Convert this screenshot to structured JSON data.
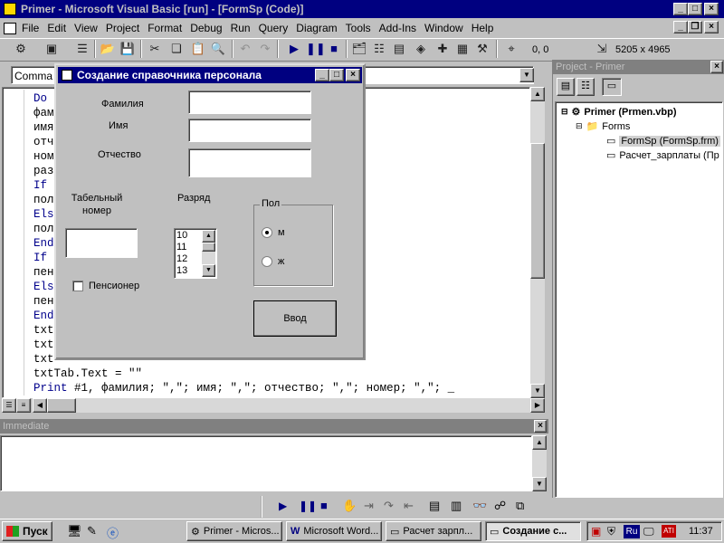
{
  "main_window": {
    "title": "Primer - Microsoft Visual Basic [run] - [FormSp (Code)]",
    "menu": [
      "File",
      "Edit",
      "View",
      "Project",
      "Format",
      "Debug",
      "Run",
      "Query",
      "Diagram",
      "Tools",
      "Add-Ins",
      "Window",
      "Help"
    ],
    "toolbar": {
      "position_readout": "0, 0",
      "size_readout": "5205 x 4965"
    }
  },
  "code_window": {
    "object_combo": "Comma",
    "lines": [
      {
        "kw": "Do ",
        "rest": ""
      },
      {
        "kw": "",
        "rest": "фам"
      },
      {
        "kw": "",
        "rest": "имя"
      },
      {
        "kw": "",
        "rest": "отч"
      },
      {
        "kw": "",
        "rest": "ном"
      },
      {
        "kw": "",
        "rest": "раз"
      },
      {
        "kw": "If ",
        "rest": ""
      },
      {
        "kw": "",
        "rest": "пол"
      },
      {
        "kw": "Els",
        "rest": ""
      },
      {
        "kw": "",
        "rest": "пол"
      },
      {
        "kw": "End",
        "rest": ""
      },
      {
        "kw": "If ",
        "rest": ""
      },
      {
        "kw": "",
        "rest": "пен"
      },
      {
        "kw": "Els",
        "rest": ""
      },
      {
        "kw": "",
        "rest": "пен"
      },
      {
        "kw": "End",
        "rest": ""
      },
      {
        "kw": "",
        "rest": "txt"
      },
      {
        "kw": "",
        "rest": "txt"
      },
      {
        "kw": "",
        "rest": "txt"
      },
      {
        "kw": "",
        "rest": "txtTab.Text = \"\""
      },
      {
        "kw": "Print",
        "rest": " #1, фамилия; \",\"; имя; \",\"; отчество; \",\"; номер; \",\"; _"
      }
    ]
  },
  "form": {
    "title": "Создание справочника персонала",
    "label_surname": "Фамилия",
    "label_name": "Имя",
    "label_patronymic": "Отчество",
    "label_tab_number": "Табельный номер",
    "label_grade": "Разряд",
    "grade_options": [
      "10",
      "11",
      "12",
      "13"
    ],
    "gender_frame": "Пол",
    "gender_m": "м",
    "gender_f": "ж",
    "pensioner_label": "Пенсионер",
    "submit_label": "Ввод"
  },
  "project_panel": {
    "title": "Project - Primer",
    "root": "Primer (Prmen.vbp)",
    "folder": "Forms",
    "items": [
      "FormSp (FormSp.frm)",
      "Расчет_зарплаты (Пр"
    ]
  },
  "immediate": {
    "title": "Immediate"
  },
  "taskbar": {
    "start": "Пуск",
    "tasks": [
      "Primer - Micros...",
      "Microsoft Word...",
      "Расчет зарпл...",
      "Создание с..."
    ],
    "clock": "11:37",
    "lang": "Ru"
  },
  "colors": {
    "titlebar": "#000080",
    "desktop": "#c0c0c0",
    "keyword": "#00008b"
  }
}
